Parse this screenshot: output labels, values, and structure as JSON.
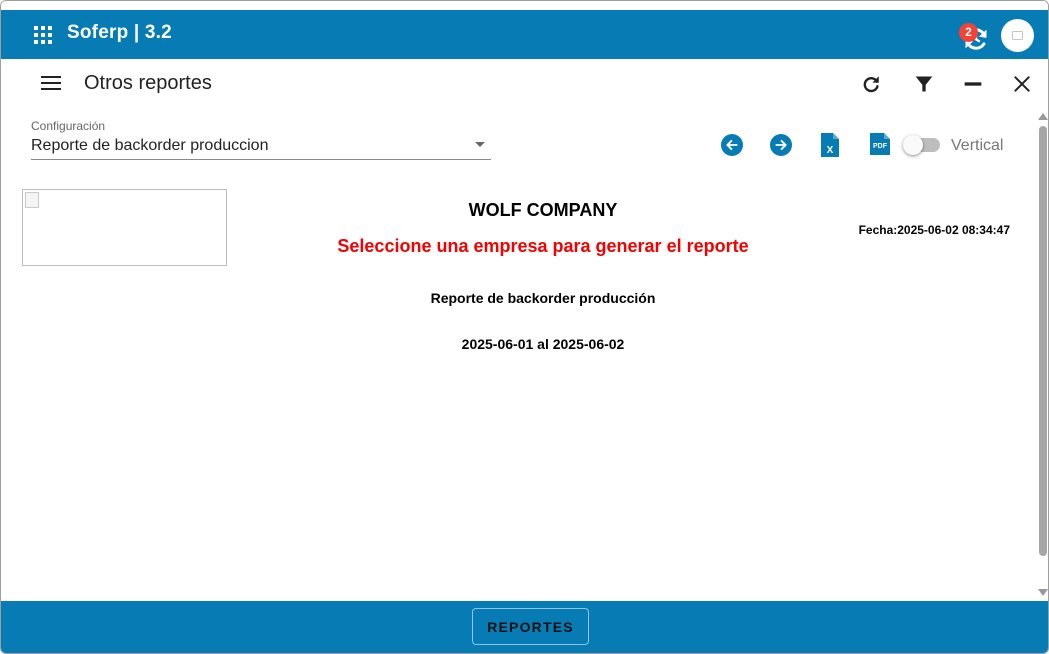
{
  "app": {
    "title": "Soferp | 3.2",
    "notification_count": "2",
    "icons": {
      "apps": "apps-grid-icon",
      "sync": "sync-history-icon",
      "avatar": "avatar-image-icon"
    }
  },
  "toolbar": {
    "title": "Otros reportes",
    "icons": [
      "menu-icon",
      "refresh-icon",
      "filter-icon",
      "minimize-icon",
      "close-icon"
    ]
  },
  "config": {
    "label": "Configuración",
    "selected": "Reporte de backorder produccion"
  },
  "actions": {
    "toggle_label": "Vertical",
    "toggle_on": false,
    "excel_glyph": "X",
    "pdf_glyph": "PDF"
  },
  "report": {
    "company": "WOLF COMPANY",
    "fecha": "Fecha:2025-06-02 08:34:47",
    "warning": "Seleccione una empresa para generar el reporte",
    "name": "Reporte de backorder producción",
    "date_range": "2025-06-01 al 2025-06-02"
  },
  "bottom": {
    "button_label": "REPORTES"
  },
  "colors": {
    "primary": "#077cb4",
    "warning": "#f40000",
    "badge": "#f44336"
  }
}
